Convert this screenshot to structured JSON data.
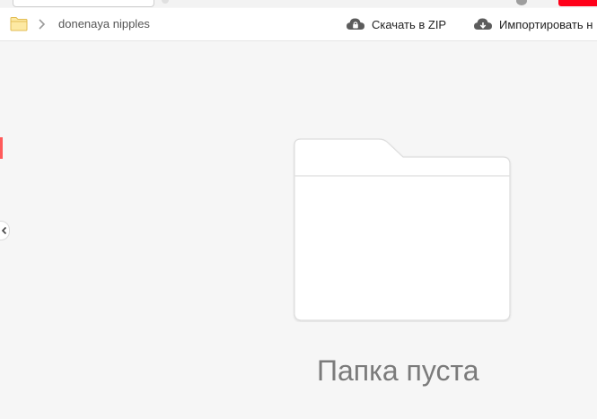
{
  "breadcrumb": {
    "folder_icon": "folder-icon",
    "separator_icon": "chevron-right-icon",
    "current": "donenaya nipples"
  },
  "toolbar": {
    "download_zip": {
      "icon": "cloud-lock-icon",
      "label": "Скачать в ZIP"
    },
    "import": {
      "icon": "cloud-download-icon",
      "label": "Импортировать н"
    }
  },
  "sidebar": {
    "collapse_icon": "chevron-left-icon"
  },
  "empty_state": {
    "illustration": "empty-folder-icon",
    "message": "Папка пуста"
  },
  "colors": {
    "accent_red": "#ff0019",
    "folder_yellow": "#fde9a3",
    "folder_stroke": "#e9c766",
    "text_primary": "#222222",
    "text_secondary": "#555555",
    "empty_text": "#7b7b7b"
  }
}
